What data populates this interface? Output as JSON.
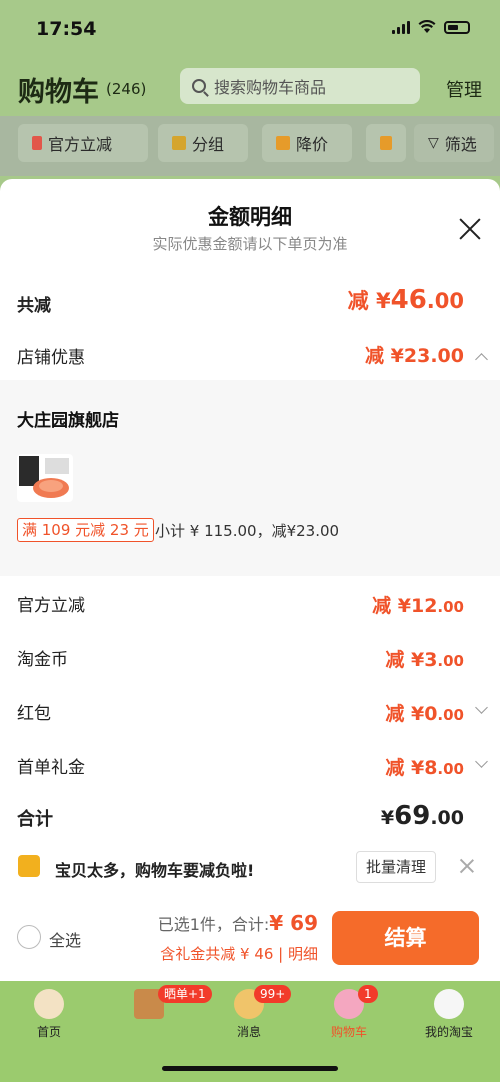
{
  "status_bar": {
    "time": "17:54"
  },
  "header": {
    "title": "购物车",
    "count": "(246)",
    "search_placeholder": "搜索购物车商品",
    "manage": "管理"
  },
  "filters": [
    "官方立减",
    "分组",
    "降价",
    "筛选"
  ],
  "sheet": {
    "title": "金额明细",
    "subtitle": "实际优惠金额请以下单页为准",
    "total_reduce": {
      "label": "共减",
      "prefix": "减 ¥",
      "int": "46",
      "dec": ".00"
    },
    "store_discount": {
      "label": "店铺优惠",
      "prefix": "减 ¥",
      "int": "23",
      "dec": ".00"
    },
    "shop": {
      "name": "大庄园旗舰店",
      "promo": "满 109 元减 23 元",
      "subtotal": "小计 ¥ 115.00，减¥23.00"
    },
    "items": [
      {
        "label": "官方立减",
        "prefix": "减 ¥",
        "int": "12",
        "dec": ".00"
      },
      {
        "label": "淘金币",
        "prefix": "减 ¥",
        "int": "3",
        "dec": ".00"
      },
      {
        "label": "红包",
        "prefix": "减 ¥",
        "int": "0",
        "dec": ".00"
      },
      {
        "label": "首单礼金",
        "prefix": "减 ¥",
        "int": "8",
        "dec": ".00"
      }
    ],
    "total": {
      "label": "合计",
      "prefix": "¥",
      "int": "69",
      "dec": ".00"
    }
  },
  "notice": {
    "text": "宝贝太多，购物车要减负啦!",
    "button": "批量清理"
  },
  "checkout": {
    "select_all": "全选",
    "selected": "已选1件，合计:",
    "total_value": "¥ 69",
    "gift": "含礼金共减 ¥ 46 | 明细",
    "pay": "结算"
  },
  "tabbar": {
    "tabs": [
      "首页",
      "",
      "消息",
      "购物车",
      "我的淘宝"
    ],
    "badges": [
      "晒单+1",
      "99+",
      "1"
    ]
  },
  "colors": {
    "accent": "#f0532a",
    "button": "#f56b2a"
  }
}
